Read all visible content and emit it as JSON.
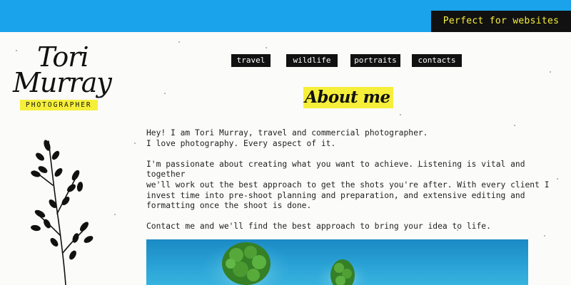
{
  "header": {
    "badge": "Perfect for websites",
    "accent_color": "#1aa3ea",
    "highlight_color": "#f6ef3a"
  },
  "logo": {
    "first_name": "Tori",
    "last_name": "Murray",
    "tagline": "PHOTOGRAPHER"
  },
  "nav": {
    "items": [
      {
        "label": "travel"
      },
      {
        "label": "wildlife"
      },
      {
        "label": "portraits"
      },
      {
        "label": "contacts"
      }
    ]
  },
  "main": {
    "heading": "About me",
    "paragraphs": [
      "Hey! I am Tori Murray, travel and commercial photographer.\nI love photography. Every aspect of it.",
      "I'm passionate about creating what you want to achieve. Listening is vital and together\nwe'll work out the best approach to get the shots you're after. With every client I\ninvest time into pre-shoot planning and preparation, and extensive editing and\nformatting once the shoot is done.",
      "Contact me and we'll find the best approach to bring your idea to life."
    ],
    "photo_icon": "aerial-islands-photo"
  },
  "decor": {
    "plant_icon": "plant-illustration-icon"
  }
}
